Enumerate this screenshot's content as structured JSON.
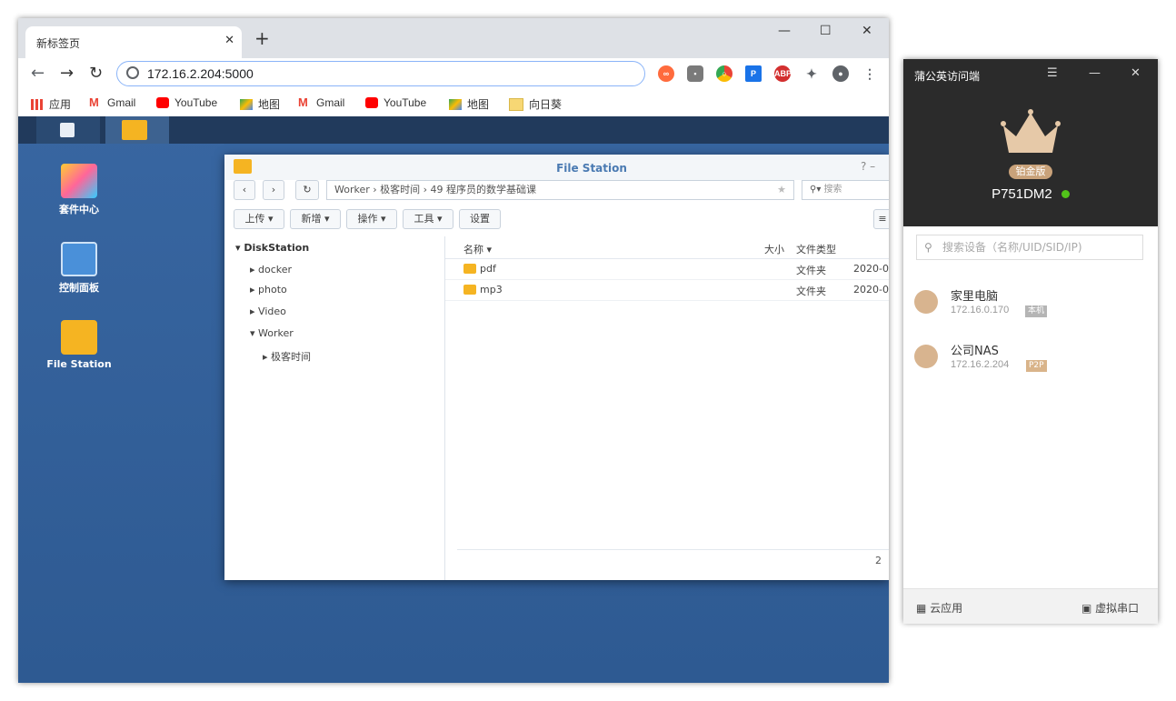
{
  "browser": {
    "tab_title": "新标签页",
    "tab_close": "✕",
    "new_tab": "+",
    "window_controls": [
      "—",
      "☐",
      "✕"
    ],
    "url": "172.16.2.204:5000",
    "bookmarks": [
      {
        "label": "应用",
        "icon": "apps-grid-icon"
      },
      {
        "label": "Gmail",
        "icon": "gmail-icon"
      },
      {
        "label": "YouTube",
        "icon": "youtube-icon"
      },
      {
        "label": "地图",
        "icon": "maps-icon"
      },
      {
        "label": "Gmail",
        "icon": "gmail-icon"
      },
      {
        "label": "YouTube",
        "icon": "youtube-icon"
      },
      {
        "label": "地图",
        "icon": "maps-icon"
      },
      {
        "label": "向日葵",
        "icon": "folder-icon"
      }
    ]
  },
  "desktop": {
    "icons": [
      {
        "label": "套件中心"
      },
      {
        "label": "控制面板"
      },
      {
        "label": "File Station"
      }
    ]
  },
  "file_station": {
    "title": "File Station",
    "title_controls": "?  –",
    "path": "Worker  ›  极客时间  ›  49 程序员的数学基础课",
    "search_placeholder": "搜索",
    "buttons": [
      "上传 ▾",
      "新增 ▾",
      "操作 ▾",
      "工具 ▾",
      "设置"
    ],
    "tree": {
      "root": "DiskStation",
      "items": [
        "docker",
        "photo",
        "Video",
        "Worker"
      ],
      "sub": "极客时间"
    },
    "columns": [
      "名称 ▾",
      "大小",
      "文件类型"
    ],
    "rows": [
      {
        "name": "pdf",
        "type": "文件夹",
        "date": "2020-0"
      },
      {
        "name": "mp3",
        "type": "文件夹",
        "date": "2020-0"
      }
    ],
    "footer_count": "2"
  },
  "pgy": {
    "title": "蒲公英访问端",
    "edition": "铂金版",
    "device_name": "P751DM2",
    "search_placeholder": "搜索设备（名称/UID/SID/IP)",
    "devices": [
      {
        "name": "家里电脑",
        "ip": "172.16.0.170",
        "tag": "本机",
        "tag_color": "#b5b5b5"
      },
      {
        "name": "公司NAS",
        "ip": "172.16.2.204",
        "tag": "P2P",
        "tag_color": "#d9b48a"
      }
    ],
    "footer": {
      "left": "云应用",
      "right": "虚拟串口"
    }
  }
}
